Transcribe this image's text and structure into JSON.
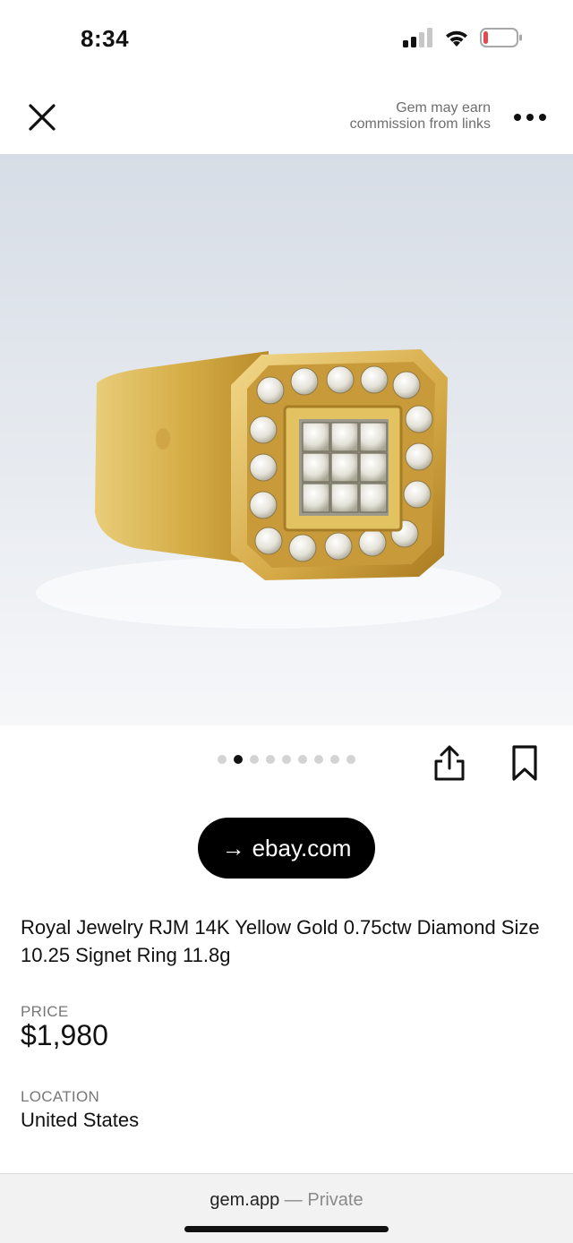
{
  "status_bar": {
    "time": "8:34",
    "icons": [
      "signal-icon",
      "wifi-icon",
      "battery-low-icon"
    ],
    "battery_color": "#e5484d"
  },
  "header": {
    "close_icon": "close-icon",
    "disclaimer_line1": "Gem may earn",
    "disclaimer_line2": "commission from links",
    "more_icon": "more-horizontal-icon"
  },
  "gallery": {
    "image_count": 9,
    "active_index": 1,
    "share_icon": "share-icon",
    "bookmark_icon": "bookmark-icon"
  },
  "listing": {
    "source_button": "→ ebay.com",
    "source_arrow": "→",
    "source_domain": "ebay.com",
    "title": "Royal Jewelry RJM 14K Yellow Gold 0.75ctw Diamond Size 10.25 Signet Ring 11.8g",
    "price_label": "PRICE",
    "price": "$1,980",
    "location_label": "LOCATION",
    "location": "United States"
  },
  "browser_bar": {
    "domain": "gem.app",
    "separator": " — ",
    "privacy": "Private"
  },
  "colors": {
    "accent": "#000000",
    "muted_text": "#777777",
    "gold": "#d9b24a"
  }
}
